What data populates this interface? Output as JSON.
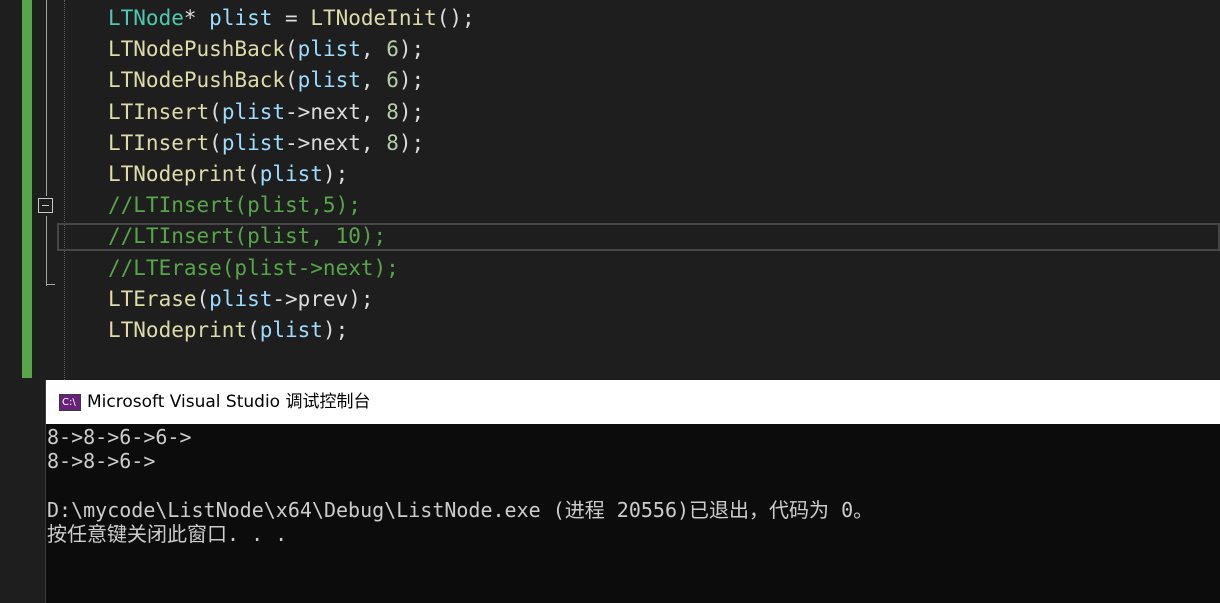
{
  "editor": {
    "lines": [
      {
        "parts": [
          [
            "ty",
            "LTNode"
          ],
          [
            "pl",
            "* "
          ],
          [
            "var",
            "plist"
          ],
          [
            "pl",
            " = "
          ],
          [
            "fn",
            "LTNodeInit"
          ],
          [
            "pl",
            "();"
          ]
        ]
      },
      {
        "parts": [
          [
            "fn",
            "LTNodePushBack"
          ],
          [
            "pl",
            "("
          ],
          [
            "var",
            "plist"
          ],
          [
            "pl",
            ", "
          ],
          [
            "num",
            "6"
          ],
          [
            "pl",
            ");"
          ]
        ]
      },
      {
        "parts": [
          [
            "fn",
            "LTNodePushBack"
          ],
          [
            "pl",
            "("
          ],
          [
            "var",
            "plist"
          ],
          [
            "pl",
            ", "
          ],
          [
            "num",
            "6"
          ],
          [
            "pl",
            ");"
          ]
        ]
      },
      {
        "parts": [
          [
            "fn",
            "LTInsert"
          ],
          [
            "pl",
            "("
          ],
          [
            "var",
            "plist"
          ],
          [
            "pl",
            "->next, "
          ],
          [
            "num",
            "8"
          ],
          [
            "pl",
            ");"
          ]
        ]
      },
      {
        "parts": [
          [
            "fn",
            "LTInsert"
          ],
          [
            "pl",
            "("
          ],
          [
            "var",
            "plist"
          ],
          [
            "pl",
            "->next, "
          ],
          [
            "num",
            "8"
          ],
          [
            "pl",
            ");"
          ]
        ]
      },
      {
        "parts": [
          [
            "fn",
            "LTNodeprint"
          ],
          [
            "pl",
            "("
          ],
          [
            "var",
            "plist"
          ],
          [
            "pl",
            ");"
          ]
        ]
      },
      {
        "parts": [
          [
            "cm",
            "//LTInsert(plist,5);"
          ]
        ]
      },
      {
        "parts": [
          [
            "cm",
            "//LTInsert(plist, 10);"
          ]
        ]
      },
      {
        "parts": [
          [
            "cm",
            "//LTErase(plist->next);"
          ]
        ]
      },
      {
        "parts": [
          [
            "fn",
            "LTErase"
          ],
          [
            "pl",
            "("
          ],
          [
            "var",
            "plist"
          ],
          [
            "pl",
            "->prev);"
          ]
        ]
      },
      {
        "parts": [
          [
            "fn",
            "LTNodeprint"
          ],
          [
            "pl",
            "("
          ],
          [
            "var",
            "plist"
          ],
          [
            "pl",
            ");"
          ]
        ]
      }
    ]
  },
  "console": {
    "icon_text": "C:\\",
    "title": "Microsoft Visual Studio 调试控制台",
    "output": [
      "8->8->6->6->",
      "8->8->6->",
      "",
      "D:\\mycode\\ListNode\\x64\\Debug\\ListNode.exe (进程 20556)已退出，代码为 0。",
      "按任意键关闭此窗口. . ."
    ]
  },
  "colors": {
    "editor_bg": "#1e1e1e",
    "function": "#dcdcaa",
    "type": "#4ec9b0",
    "variable": "#9cdcfe",
    "number": "#b5cea8",
    "comment": "#57a64a",
    "console_bg": "#0c0c0c",
    "change_bar": "#57a64a"
  }
}
